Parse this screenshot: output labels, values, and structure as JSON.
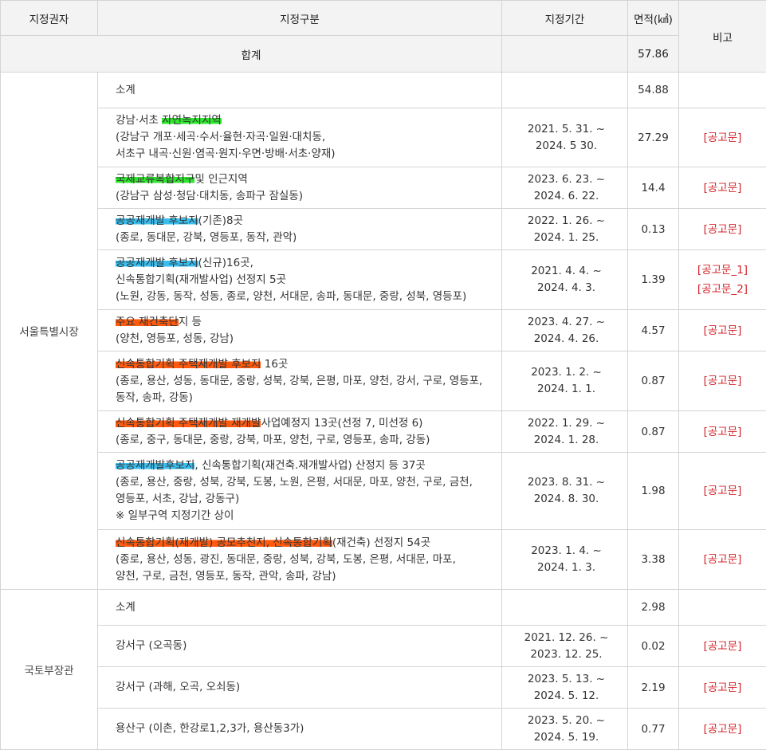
{
  "headers": {
    "authority": "지정권자",
    "category": "지정구분",
    "period": "지정기간",
    "area": "면적(㎢)",
    "note": "비고"
  },
  "total": {
    "label": "합계",
    "area": "57.86"
  },
  "groups": [
    {
      "authority": "서울특별시장",
      "subtotal": {
        "label": "소계",
        "area": "54.88"
      },
      "rows": [
        {
          "line1_pre": "강남·서초 ",
          "line1_hl": "자연녹지지역",
          "line1_post": "",
          "detail": [
            "(강남구 개포·세곡·수서·율현·자곡·일원·대치동,",
            "서초구 내곡·신원·염곡·원지·우면·방배·서초·양재)"
          ],
          "period_start": "2021. 5. 31. ~",
          "period_end": "2024. 5 30.",
          "area": "27.29",
          "notes": [
            "[공고문]"
          ]
        },
        {
          "line1_pre": "",
          "line1_hl": "국제교류복합지구",
          "line1_post": "및 인근지역",
          "detail": [
            "(강남구 삼성·청담·대치동, 송파구 잠실동)"
          ],
          "period_start": "2023. 6. 23. ~",
          "period_end": "2024. 6. 22.",
          "area": "14.4",
          "notes": [
            "[공고문]"
          ]
        },
        {
          "line1_pre": "",
          "line1_hl": "공공재개발 후보지",
          "line1_post": "(기존)8곳",
          "detail": [
            "(종로, 동대문, 강북, 영등포, 동작, 관악)"
          ],
          "period_start": "2022. 1. 26. ~",
          "period_end": "2024. 1. 25.",
          "area": "0.13",
          "notes": [
            "[공고문]"
          ]
        },
        {
          "line1_pre": "",
          "line1_hl": "공공재개발 후보지",
          "line1_post": "(신규)16곳,",
          "detail": [
            "신속통합기획(재개발사업) 선정지 5곳",
            "(노원, 강동, 동작, 성동, 종로, 양천, 서대문, 송파, 동대문, 중랑, 성북, 영등포)"
          ],
          "period_start": "2021. 4. 4. ~",
          "period_end": "2024. 4. 3.",
          "area": "1.39",
          "notes": [
            "[공고문_1]",
            "[공고문_2]"
          ]
        },
        {
          "line1_pre": "",
          "line1_hl": "주요 재건축단",
          "line1_post": "지 등",
          "detail": [
            "(양천, 영등포, 성동, 강남)"
          ],
          "period_start": "2023. 4. 27. ~",
          "period_end": "2024. 4. 26.",
          "area": "4.57",
          "notes": [
            "[공고문]"
          ]
        },
        {
          "line1_pre": "",
          "line1_hl": "신속통합기획 주택재개발 후보지",
          "line1_post": " 16곳",
          "detail": [
            "(종로, 용산, 성동, 동대문, 중랑, 성북, 강북, 은평, 마포, 양천, 강서, 구로, 영등포,",
            "동작, 송파, 강동)"
          ],
          "period_start": "2023. 1. 2. ~",
          "period_end": "2024. 1. 1.",
          "area": "0.87",
          "notes": [
            "[공고문]"
          ]
        },
        {
          "line1_pre": "",
          "line1_hl": "신속통합기획 주택재개발 재개발",
          "line1_post": "사업예정지 13곳(선정 7, 미선정 6)",
          "detail": [
            "(종로, 중구, 동대문, 중랑, 강북, 마포, 양천, 구로, 영등포, 송파, 강동)"
          ],
          "period_start": "2022. 1. 29. ~",
          "period_end": "2024. 1. 28.",
          "area": "0.87",
          "notes": [
            "[공고문]"
          ]
        },
        {
          "line1_pre": "",
          "line1_hl": "공공재개발후보지",
          "line1_post": ", 신속통합기획(재건축.재개발사업) 산정지 등 37곳",
          "detail": [
            "(종로, 용산, 중랑, 성북, 강북, 도봉, 노원, 은평, 서대문, 마포, 양천, 구로, 금천,",
            "영등포, 서초, 강남, 강동구)",
            "※ 일부구역 지정기간 상이"
          ],
          "period_start": "2023. 8. 31. ~",
          "period_end": "2024. 8. 30.",
          "area": "1.98",
          "notes": [
            "[공고문]"
          ]
        },
        {
          "line1_pre": "",
          "line1_hl": "신속통합기획(재개발) 공모추천지, 신속통합기획",
          "line1_post": "(재건축) 선정지 54곳",
          "detail": [
            "(종로, 용산, 성동, 광진, 동대문, 중랑, 성북, 강북, 도봉, 은평, 서대문, 마포,",
            "양천, 구로, 금천, 영등포, 동작, 관악, 송파, 강남)"
          ],
          "period_start": "2023. 1. 4. ~",
          "period_end": "2024. 1. 3.",
          "area": "3.38",
          "notes": [
            "[공고문]"
          ]
        }
      ]
    },
    {
      "authority": "국토부장관",
      "subtotal": {
        "label": "소계",
        "area": "2.98"
      },
      "rows": [
        {
          "line1_pre": "강서구 (오곡동)",
          "line1_hl": "",
          "line1_post": "",
          "detail": [],
          "period_start": "2021. 12. 26. ~",
          "period_end": "2023. 12. 25.",
          "area": "0.02",
          "notes": [
            "[공고문]"
          ]
        },
        {
          "line1_pre": "강서구 (과해, 오곡, 오쇠동)",
          "line1_hl": "",
          "line1_post": "",
          "detail": [],
          "period_start": "2023. 5. 13. ~",
          "period_end": "2024. 5. 12.",
          "area": "2.19",
          "notes": [
            "[공고문]"
          ]
        },
        {
          "line1_pre": "용산구 (이촌, 한강로1,2,3가, 용산동3가)",
          "line1_hl": "",
          "line1_post": "",
          "detail": [],
          "period_start": "2023. 5. 20. ~",
          "period_end": "2024. 5. 19.",
          "area": "0.77",
          "notes": [
            "[공고문]"
          ]
        }
      ]
    }
  ],
  "highlight_colors": {
    "green": "#2fe52f",
    "blue": "#38bff0",
    "orange": "#ff5a0d",
    "link": "#d2232a"
  }
}
